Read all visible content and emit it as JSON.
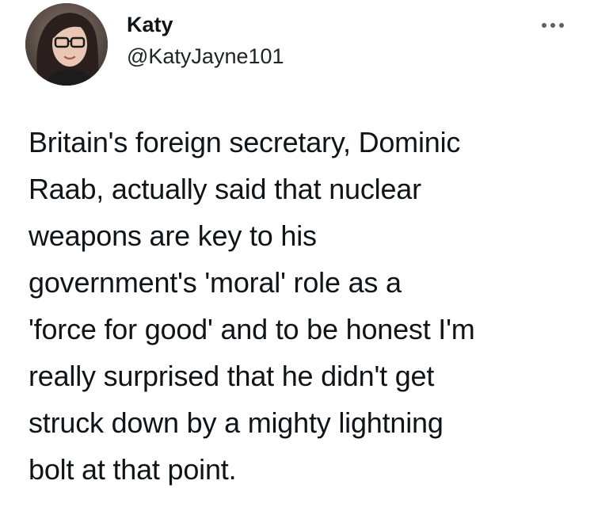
{
  "author": {
    "display_name": "Katy",
    "handle": "@KatyJayne101"
  },
  "tweet": {
    "text": "Britain's foreign secretary, Dominic\nRaab, actually said that nuclear\nweapons are key to his\ngovernment's 'moral' role as a\n'force for good' and to be honest I'm\nreally surprised that he didn't get\nstruck down by a mighty lightning\nbolt at that point."
  },
  "icons": {
    "more": "more-horizontal-icon",
    "avatar": "profile-photo"
  },
  "colors": {
    "text": "#0f1419",
    "secondary": "#536471",
    "background": "#ffffff"
  }
}
